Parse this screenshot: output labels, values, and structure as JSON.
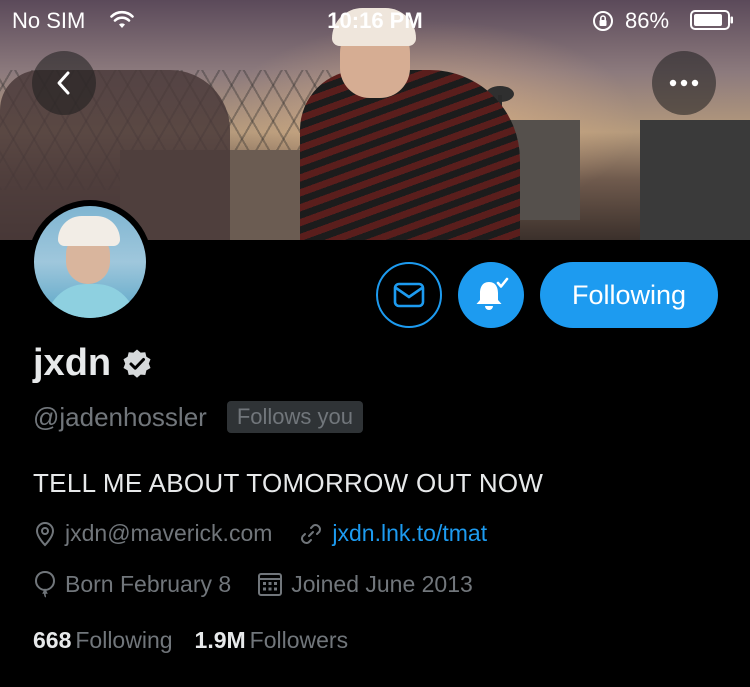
{
  "status_bar": {
    "carrier": "No SIM",
    "time": "10:16 PM",
    "battery_pct": "86%"
  },
  "profile": {
    "name": "jxdn",
    "handle": "@jadenhossler",
    "follows_you": "Follows you",
    "bio": "TELL ME ABOUT TOMORROW OUT NOW",
    "email": "jxdn@maverick.com",
    "link": "jxdn.lnk.to/tmat",
    "birthday": "Born February 8",
    "joined": "Joined June 2013",
    "following_count": "668",
    "following_label": "Following",
    "followers_count": "1.9M",
    "followers_label": "Followers"
  },
  "actions": {
    "following_button": "Following"
  },
  "colors": {
    "accent": "#1d9bf0",
    "muted": "#71767b",
    "background": "#000000"
  },
  "icons": {
    "back": "chevron-left-icon",
    "more": "more-horizontal-icon",
    "message": "envelope-icon",
    "notifications": "bell-check-icon",
    "verified": "verified-badge-icon",
    "location": "location-pin-icon",
    "link": "link-icon",
    "birthday": "balloon-icon",
    "calendar": "calendar-icon"
  }
}
